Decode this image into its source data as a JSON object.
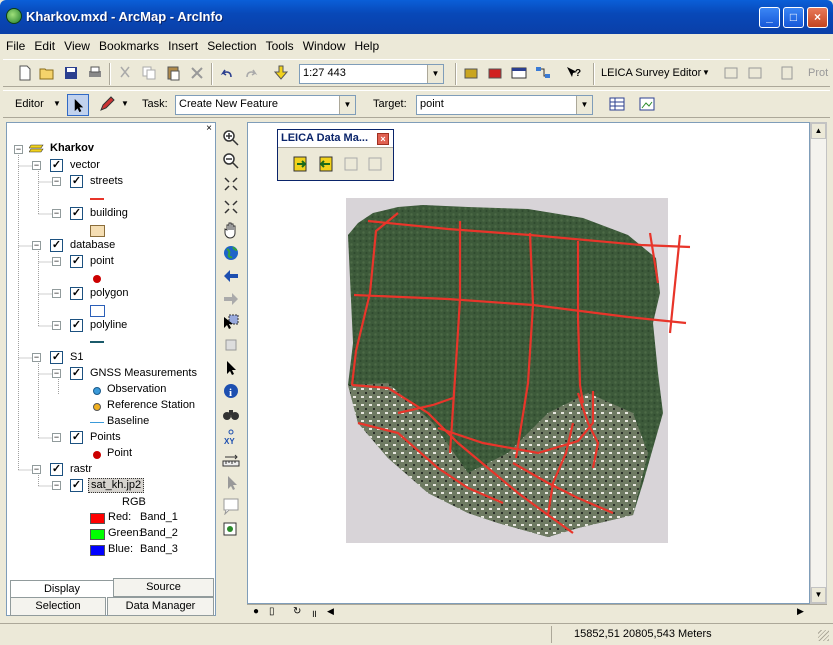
{
  "window": {
    "title": "Kharkov.mxd - ArcMap - ArcInfo",
    "buttons": [
      "_",
      "□",
      "×"
    ]
  },
  "menu": [
    "File",
    "Edit",
    "View",
    "Bookmarks",
    "Insert",
    "Selection",
    "Tools",
    "Window",
    "Help"
  ],
  "toolbar1": {
    "scale": "1:27 443",
    "leica_editor": "LEICA Survey Editor",
    "prot": "Prot"
  },
  "toolbar2": {
    "editor": "Editor",
    "task_label": "Task:",
    "task_value": "Create New Feature",
    "target_label": "Target:",
    "target_value": "point"
  },
  "leica_panel": {
    "title": "LEICA Data Ma..."
  },
  "toc": {
    "root": "Kharkov",
    "groups": [
      {
        "name": "vector",
        "layers": [
          {
            "name": "streets"
          },
          {
            "name": "building"
          }
        ]
      },
      {
        "name": "database",
        "layers": [
          {
            "name": "point"
          },
          {
            "name": "polygon"
          },
          {
            "name": "polyline"
          }
        ]
      },
      {
        "name": "S1",
        "layers": [
          {
            "name": "GNSS Measurements",
            "legend": [
              "Observation",
              "Reference Station",
              "Baseline"
            ]
          },
          {
            "name": "Points",
            "legend": [
              "Point"
            ]
          }
        ]
      },
      {
        "name": "rastr",
        "layers": [
          {
            "name": "sat_kh.jp2",
            "legend_title": "RGB",
            "bands": [
              {
                "label": "Red:",
                "value": "Band_1",
                "color": "#ff0000"
              },
              {
                "label": "Green:",
                "value": "Band_2",
                "color": "#00ff00"
              },
              {
                "label": "Blue:",
                "value": "Band_3",
                "color": "#0000ff"
              }
            ]
          }
        ]
      }
    ]
  },
  "tabs": {
    "display": "Display",
    "source": "Source",
    "selection": "Selection",
    "data_manager": "Data Manager"
  },
  "status": {
    "coords": "15852,51  20805,543 Meters"
  },
  "colors": {
    "street": "#e8352a",
    "title_blue": "#0a5fd8",
    "point_red": "#cc0000"
  }
}
